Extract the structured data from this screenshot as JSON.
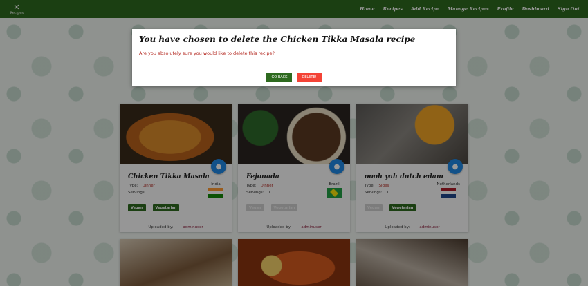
{
  "nav": {
    "brand": "Recipes",
    "links": [
      "Home",
      "Recipes",
      "Add Recipe",
      "Manage Recipes",
      "Profile",
      "Dashboard",
      "Sign Out"
    ]
  },
  "modal": {
    "title": "You have chosen to delete the Chicken Tikka Masala recipe",
    "message": "Are you absolutely sure you would like to delete this recipe?",
    "back_label": "GO BACK",
    "delete_label": "DELETE!"
  },
  "labels": {
    "type": "Type:",
    "servings": "Servings:",
    "uploaded_by": "Uploaded by:"
  },
  "recipes": [
    {
      "title": "Chicken Tikka Masala",
      "type": "Dinner",
      "servings": "1",
      "country": "India",
      "vegan": "Vegan",
      "vegetarian": "Vegetarian",
      "user": "adminuser"
    },
    {
      "title": "Fejouada",
      "type": "Dinner",
      "servings": "1",
      "country": "Brazil",
      "vegan": "Vegan",
      "vegetarian": "Vegetarian",
      "user": "adminuser"
    },
    {
      "title": "oooh yah dutch edam",
      "type": "Sides",
      "servings": "1",
      "country": "Netherlands",
      "vegan": "Vegan",
      "vegetarian": "Vegetarian",
      "user": "adminuser"
    }
  ]
}
